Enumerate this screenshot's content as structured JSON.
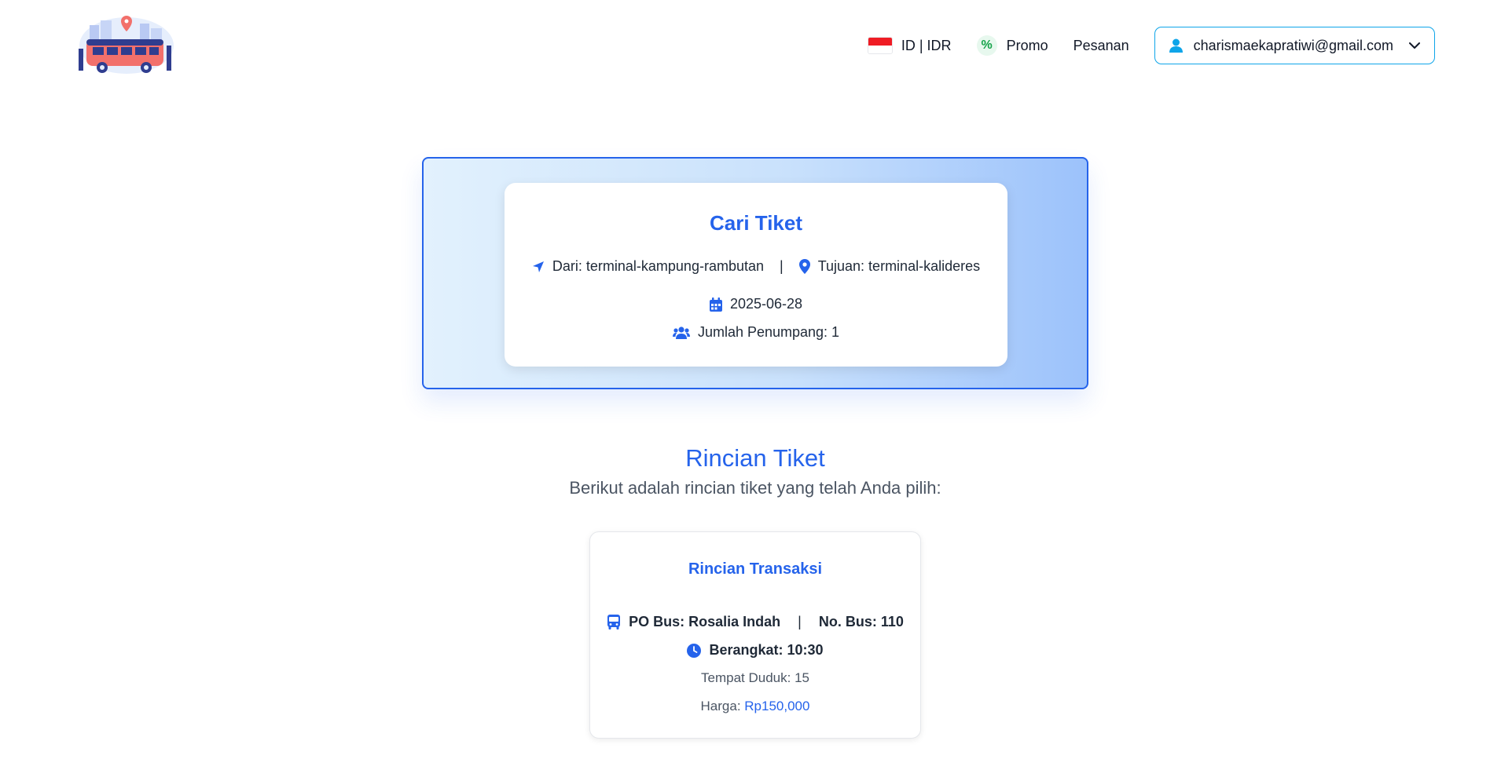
{
  "nav": {
    "locale_label": "ID | IDR",
    "promo_symbol": "%",
    "promo_label": "Promo",
    "orders_label": "Pesanan",
    "user_email": "charismaekapratiwi@gmail.com"
  },
  "search": {
    "title": "Cari Tiket",
    "from": "Dari: terminal-kampung-rambutan",
    "separator": "|",
    "to": "Tujuan: terminal-kalideres",
    "date": "2025-06-28",
    "passengers": "Jumlah Penumpang: 1"
  },
  "detail": {
    "title": "Rincian Tiket",
    "subtitle": "Berikut adalah rincian tiket yang telah Anda pilih:"
  },
  "transaction": {
    "title": "Rincian Transaksi",
    "po_bus": "PO Bus: Rosalia Indah",
    "separator": "|",
    "bus_no": "No. Bus: 110",
    "departure": "Berangkat: 10:30",
    "seat": "Tempat Duduk: 15",
    "price_label": "Harga:",
    "price_value": "Rp150,000"
  },
  "icons": {
    "flag": "indonesia-flag-icon",
    "promo": "percent-icon",
    "user": "user-icon",
    "chevron": "chevron-down-icon",
    "from": "location-arrow-icon",
    "to": "map-pin-icon",
    "date": "calendar-icon",
    "passengers": "users-icon",
    "bus": "bus-icon",
    "time": "clock-icon"
  },
  "colors": {
    "primary": "#2563eb",
    "accent_border": "#0ea5e9",
    "promo_green": "#16a34a",
    "flag_red": "#ef1c24"
  }
}
